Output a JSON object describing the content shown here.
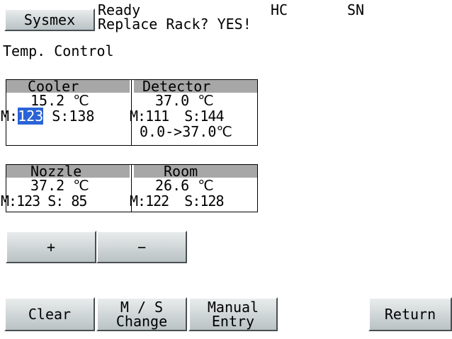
{
  "header": {
    "logo_label": "Sysmex",
    "status_line": "Ready",
    "message_line": "Replace Rack? YES!",
    "hc_label": "HC",
    "sn_label": "SN"
  },
  "screen_title": "Temp. Control",
  "cooler": {
    "title": "Cooler",
    "temp": "15.2 ℃",
    "m_prefix": "M:",
    "m_value": "123",
    "s_text": " S:138"
  },
  "detector": {
    "title": "Detector",
    "temp": "37.0 ℃",
    "ms_line": "M:111  S:144",
    "range_line": "0.0->37.0℃"
  },
  "nozzle": {
    "title": "Nozzle",
    "temp": "37.2 ℃",
    "ms_line": "M:123 S: 85"
  },
  "room": {
    "title": "Room",
    "temp": "26.6 ℃",
    "ms_line": "M:122  S:128"
  },
  "adjust": {
    "plus_label": "+",
    "minus_label": "−"
  },
  "footer": {
    "clear_label": "Clear",
    "ms_change_line1": "M / S",
    "ms_change_line2": "Change",
    "manual_entry_line1": "Manual",
    "manual_entry_line2": "Entry",
    "return_label": "Return"
  },
  "colors": {
    "panel_header": "#a7a7a7",
    "selection": "#2a63d6",
    "button_face": "#c9d0d2"
  }
}
